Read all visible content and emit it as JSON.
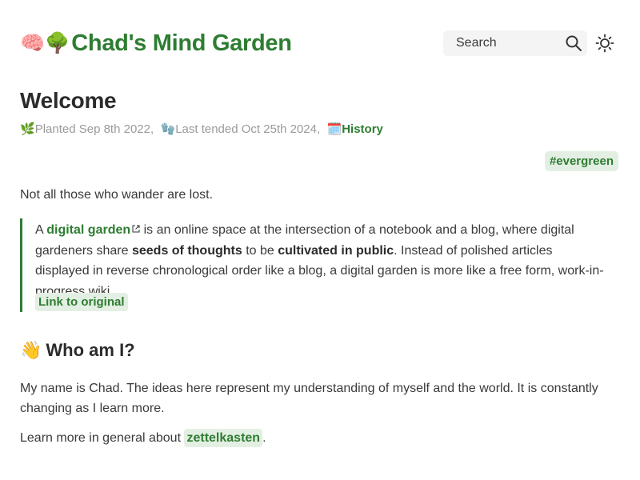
{
  "header": {
    "brand_emoji": "🧠🌳",
    "site_title": "Chad's Mind Garden",
    "search_label": "Search",
    "icons": [
      "search-icon",
      "sun-icon"
    ]
  },
  "page": {
    "title": "Welcome",
    "meta": {
      "planted_icon": "🌿",
      "planted": "Planted Sep 8th 2022,",
      "tended_icon": "🧤",
      "tended": "Last tended Oct 25th 2024,",
      "history_icon": "🗓️",
      "history": "History"
    },
    "tag": "#evergreen",
    "intro": "Not all those who wander are lost.",
    "quote": {
      "prefix": "A ",
      "link": "digital garden",
      "mid1": " is an online space at the intersection of a notebook and a blog, where digital gardeners share ",
      "bold1": "seeds of thoughts",
      "mid2": " to be ",
      "bold2": "cultivated in public",
      "rest": ". Instead of polished articles displayed in reverse chrono­logical order like a blog, a digital garden is more like a free form, work-in-progress wiki.",
      "original_link": "Link to original"
    },
    "section": {
      "emoji": "👋",
      "heading": "Who am I?",
      "body": "My name is Chad. The ideas here represent my understanding of myself and the world. It is constantly changing as I learn more.",
      "more_prefix": "Learn more in general about ",
      "more_link": "zettelkasten",
      "more_suffix": "."
    }
  },
  "colors": {
    "accent": "#2e7d32",
    "tag_bg": "#e3efe3",
    "search_bg": "#f3f4f3",
    "muted": "#9a9a9a"
  }
}
